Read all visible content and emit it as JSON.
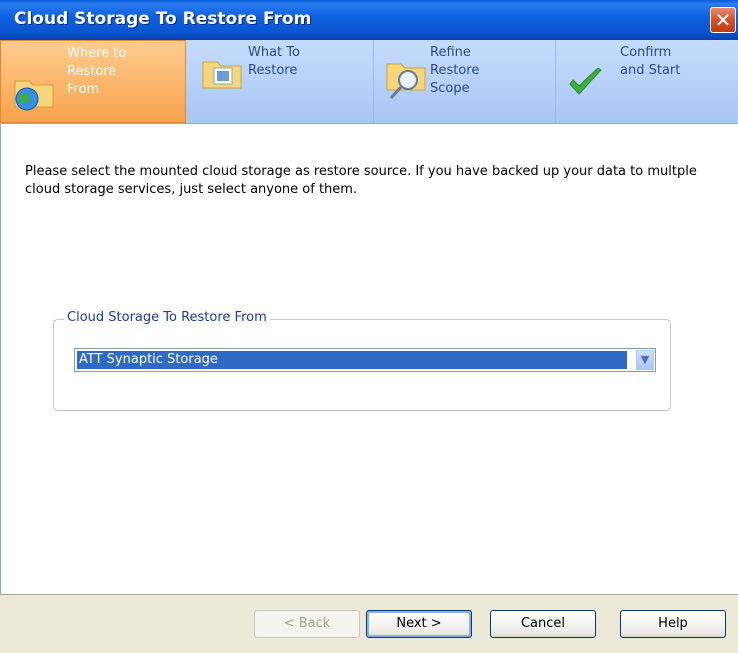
{
  "window": {
    "title": "Cloud Storage To Restore From",
    "close_label": "✕"
  },
  "steps": [
    {
      "label": "Where to\nRestore\nFrom",
      "icon": "globe-folder-icon",
      "active": true
    },
    {
      "label": "What To\nRestore",
      "icon": "folder-document-icon",
      "active": false
    },
    {
      "label": "Refine\nRestore\nScope",
      "icon": "folder-magnifier-icon",
      "active": false
    },
    {
      "label": "Confirm\nand Start",
      "icon": "checkmark-icon",
      "active": false
    }
  ],
  "content": {
    "description": "Please select the mounted cloud storage as restore source. If you have backed up your data to multple cloud storage services, just select anyone of them.",
    "group_label": "Cloud Storage To Restore From",
    "selected_storage": "ATT Synaptic Storage"
  },
  "buttons": {
    "back": "< Back",
    "next": "Next >",
    "cancel": "Cancel",
    "help": "Help"
  }
}
